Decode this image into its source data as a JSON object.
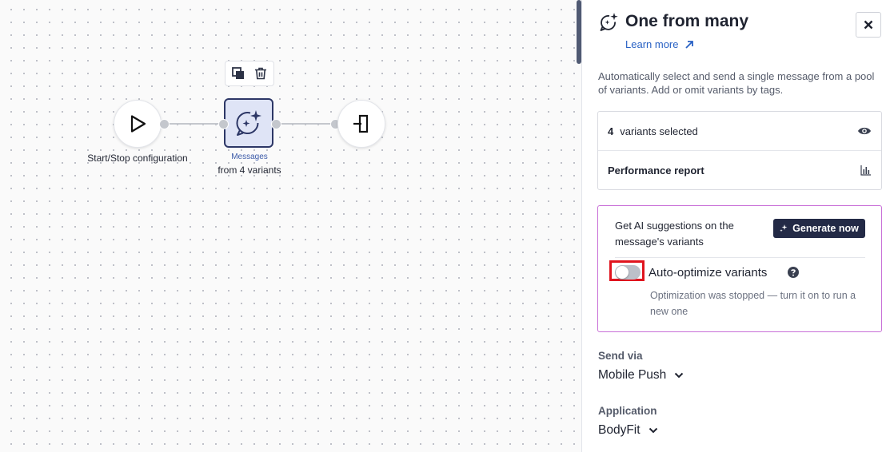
{
  "canvas": {
    "start_node": {
      "label": "Start/Stop configuration"
    },
    "message_node": {
      "title": "Messages",
      "subtitle": "from 4 variants"
    },
    "toolbar": {
      "copy_icon": "copy-icon",
      "delete_icon": "trash-icon"
    }
  },
  "panel": {
    "title": "One from many",
    "title_icon": "sparkle-chat-icon",
    "learn_more": "Learn more",
    "description": "Automatically select and send a single message from a pool of variants. Add or omit variants by tags.",
    "variants": {
      "count": "4",
      "label": "variants selected",
      "icon": "eye-icon"
    },
    "performance": {
      "label": "Performance report",
      "icon": "bar-chart-icon"
    },
    "ai": {
      "text": "Get AI suggestions on the message's variants",
      "button": "Generate now",
      "toggle_label": "Auto-optimize variants",
      "toggle_on": false,
      "hint": "Optimization was stopped — turn it on to run a new one"
    },
    "send_via": {
      "label": "Send via",
      "value": "Mobile Push"
    },
    "application": {
      "label": "Application",
      "value": "BodyFit"
    }
  },
  "colors": {
    "accent_dark": "#232a46",
    "link": "#2861c4",
    "ai_border": "#c86fd7",
    "highlight": "#e0141e",
    "node_fill": "#dfe4f6"
  }
}
